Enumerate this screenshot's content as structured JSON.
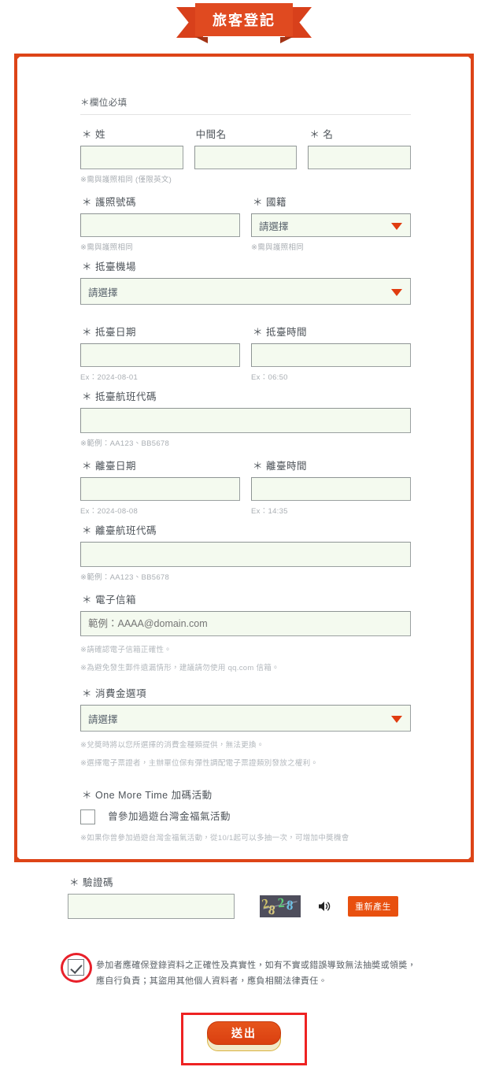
{
  "banner": {
    "title": "旅客登記"
  },
  "form": {
    "required_note": "＊欄位必填",
    "name": {
      "surname_label": "＊ 姓",
      "middle_label": "中間名",
      "given_label": "＊ 名",
      "hint": "※需與護照相同 (僅限英文)"
    },
    "passport": {
      "label": "＊ 護照號碼",
      "hint": "※需與護照相同"
    },
    "nationality": {
      "label": "＊ 國籍",
      "value": "請選擇",
      "hint": "※需與護照相同"
    },
    "arrival_airport": {
      "label": "＊ 抵臺機場",
      "value": "請選擇"
    },
    "arrival_date": {
      "label": "＊ 抵臺日期",
      "hint": "Ex：2024-08-01"
    },
    "arrival_time": {
      "label": "＊ 抵臺時間",
      "hint": "Ex：06:50"
    },
    "arrival_flight": {
      "label": "＊ 抵臺航班代碼",
      "hint": "※範例：AA123、BB5678"
    },
    "departure_date": {
      "label": "＊ 離臺日期",
      "hint": "Ex：2024-08-08"
    },
    "departure_time": {
      "label": "＊ 離臺時間",
      "hint": "Ex：14:35"
    },
    "departure_flight": {
      "label": "＊ 離臺航班代碼",
      "hint": "※範例：AA123、BB5678"
    },
    "email": {
      "label": "＊ 電子信箱",
      "placeholder": "範例：AAAA@domain.com",
      "note1": "※請確認電子信箱正確性。",
      "note2": "※為避免發生郵件遺漏情形，建議請勿使用 qq.com 信箱。"
    },
    "spending": {
      "label": "＊ 消費金選項",
      "value": "請選擇",
      "note1": "※兌奬時將以您所選擇的消費金種類提供，無法更換。",
      "note2": "※選擇電子票證者，主辦單位保有彈性調配電子票證類別發放之權利。"
    },
    "one_more_time": {
      "label": "＊ One More Time 加碼活動",
      "checkbox_label": "曾參加過遊台灣金福氣活動",
      "note": "※如果你曾參加過遊台灣金福氣活動，從10/1起可以多抽一次，可增加中奬機會"
    }
  },
  "captcha": {
    "label": "＊ 驗證碼",
    "image_chars": [
      "2",
      "8",
      "2",
      "8"
    ],
    "audio_icon": "speaker-icon",
    "regenerate_label": "重新產生"
  },
  "consent": {
    "checked": true,
    "text": "參加者應確保登錄資料之正確性及真實性，如有不實或錯誤導致無法抽奬或領奬，應自行負責；其盜用其他個人資料者，應負相關法律責任。"
  },
  "submit": {
    "label": "送出"
  },
  "colors": {
    "brand_orange": "#dd4417",
    "ribbon_red": "#e04a20",
    "field_bg": "#f4faef",
    "highlight_red": "#ee2222"
  }
}
